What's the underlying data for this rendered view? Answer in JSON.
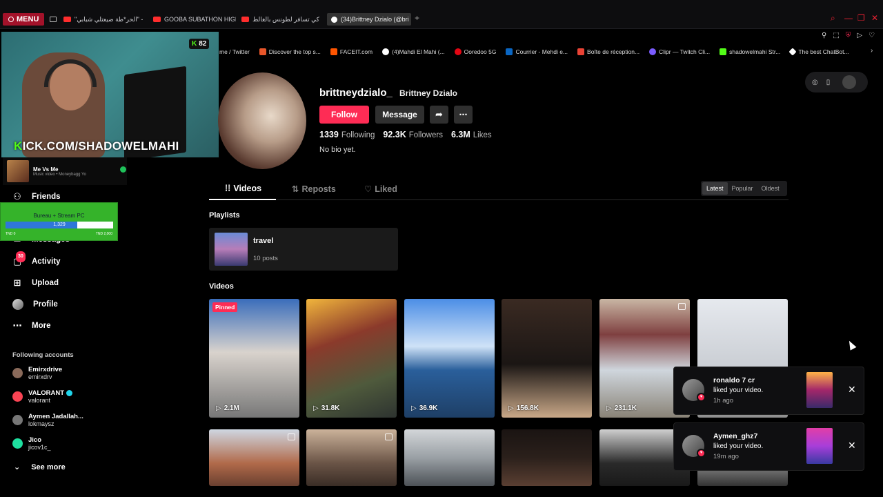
{
  "browser": {
    "menu_label": "MENU",
    "tabs": [
      {
        "label": "\"الحر*طة ضيعتلي شبابي\" -"
      },
      {
        "label": "GOOBA SUBATHON HIGH"
      },
      {
        "label": "كي تسافر لطونس بالغالط"
      },
      {
        "label": "(34)Brittney Dzialo (@bri"
      }
    ],
    "bookmarks": [
      {
        "label": "me / Twitter",
        "color": "#1d9bf0"
      },
      {
        "label": "Discover the top s...",
        "color": "#e8562a"
      },
      {
        "label": "FACEIT.com",
        "color": "#ff5500"
      },
      {
        "label": "(4)Mahdi El Mahi (...",
        "color": "#ffffff"
      },
      {
        "label": "Ooredoo 5G",
        "color": "#e30613"
      },
      {
        "label": "Courrier - Mehdi e...",
        "color": "#0a66c2"
      },
      {
        "label": "Boîte de réception...",
        "color": "#ea4335"
      },
      {
        "label": "Clipr — Twitch Cli...",
        "color": "#7b5cff"
      },
      {
        "label": "shadowelmahi Str...",
        "color": "#53fc18"
      },
      {
        "label": "The best ChatBot...",
        "color": "#ffffff"
      }
    ]
  },
  "stream": {
    "viewer_count": "82",
    "kick_url_prefix": "K",
    "kick_url_rest": "ICK.COM/SHADOWELMAHI",
    "music_title": "Me Vs Me",
    "music_sub": "Music video • Moneybagg Yo",
    "goal_title": "Bureau + Stream PC",
    "goal_value": "1,329",
    "goal_progress": 0.665,
    "goal_min": "TND 0",
    "goal_max": "TND 2,000"
  },
  "sidebar": {
    "items": [
      {
        "label": "Friends",
        "icon": "friends-icon"
      },
      {
        "label": "Messages",
        "icon": "messages-icon"
      },
      {
        "label": "Activity",
        "icon": "activity-icon",
        "badge": "30"
      },
      {
        "label": "Upload",
        "icon": "upload-icon"
      },
      {
        "label": "Profile",
        "icon": "profile-icon"
      },
      {
        "label": "More",
        "icon": "more-icon"
      }
    ],
    "following_title": "Following accounts",
    "following": [
      {
        "name": "Emirxdrive",
        "handle": "emirxdrv",
        "color": "#8a6a5a"
      },
      {
        "name": "VALORANT",
        "handle": "valorant",
        "verified": true,
        "color": "#fa4454"
      },
      {
        "name": "Aymen Jadallah...",
        "handle": "lokmaysz",
        "color": "#777"
      },
      {
        "name": "Jico",
        "handle": "jicov1c_",
        "color": "#1ee0a0"
      }
    ],
    "see_more": "See more"
  },
  "profile": {
    "username": "brittneydzialo_",
    "display_name": "Brittney Dzialo",
    "follow_label": "Follow",
    "message_label": "Message",
    "following_count": "1339",
    "following_label": "Following",
    "followers_count": "92.3K",
    "followers_label": "Followers",
    "likes_count": "6.3M",
    "likes_label": "Likes",
    "bio": "No bio yet."
  },
  "tabs": {
    "videos": "Videos",
    "reposts": "Reposts",
    "liked": "Liked",
    "sort": [
      "Latest",
      "Popular",
      "Oldest"
    ]
  },
  "playlists": {
    "title": "Playlists",
    "items": [
      {
        "name": "travel",
        "count": "10 posts"
      }
    ]
  },
  "videos": {
    "title": "Videos",
    "pinned_label": "Pinned",
    "row1": [
      {
        "views": "2.1M",
        "bg": "linear-gradient(180deg,#3a6dbb 0%,#d9d3cd 45%,#777 100%)",
        "pinned": true
      },
      {
        "views": "31.8K",
        "bg": "linear-gradient(160deg,#f1b53c 0%,#8b3a2b 35%,#4f5a3c 70%,#2d3330 100%)"
      },
      {
        "views": "36.9K",
        "bg": "linear-gradient(180deg,#4c8ee6 0%,#cfe2f7 40%,#2a5f9b 60%,#1e3f66 100%)"
      },
      {
        "views": "156.8K",
        "bg": "linear-gradient(180deg,#3a2a22 0%,#1b1614 55%,#c9a888 100%)"
      },
      {
        "views": "231.1K",
        "bg": "linear-gradient(180deg,#c9b6a4 0%,#7f4040 30%,#cfd6dd 60%,#8a8377 100%)",
        "multi": true
      },
      {
        "views": "",
        "bg": "linear-gradient(180deg,#e6e9ee 0%,#c9cdd3 60%,#8f8f8f 100%)"
      }
    ],
    "row2": [
      {
        "bg": "linear-gradient(180deg,#cfd7e2 0%,#b16a4a 60%,#6a4030 100%)",
        "multi": true
      },
      {
        "bg": "linear-gradient(180deg,#cbb29a 0%,#6a5446 60%,#3a2d26 100%)",
        "multi": true
      },
      {
        "bg": "linear-gradient(180deg,#d3d6d9 0%,#9aa0a5 50%,#4d5257 100%)"
      },
      {
        "bg": "linear-gradient(180deg,#1a1412 0%,#2b201b 50%,#5a3f32 100%)"
      },
      {
        "bg": "linear-gradient(180deg,#cfcfcf 0%,#2a2a2a 60%,#191919 100%)"
      },
      {
        "bg": "linear-gradient(180deg,#ddd 0%,#888 60%,#333 100%)"
      }
    ]
  },
  "notifications": [
    {
      "who": "ronaldo 7 cr",
      "action": "liked your video.",
      "time": "1h ago",
      "thumb": "linear-gradient(180deg,#ffb347,#a3276a,#3a2a6a)"
    },
    {
      "who": "Aymen_ghz7",
      "action": "liked your video.",
      "time": "19m ago",
      "thumb": "linear-gradient(180deg,#e13ea8,#a83ed9,#3a3aa3)"
    }
  ],
  "colors": {
    "accent": "#fe2c55",
    "kick_green": "#53fc18",
    "background": "#000000"
  }
}
